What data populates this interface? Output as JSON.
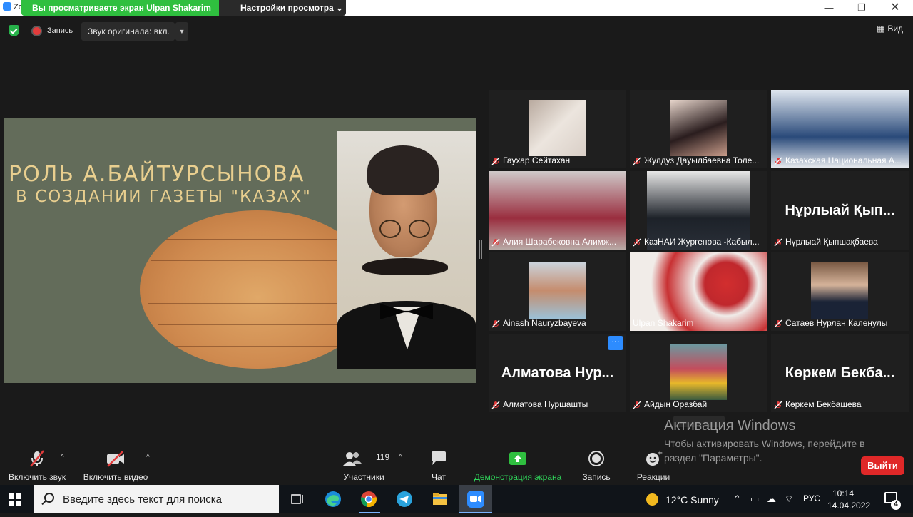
{
  "window": {
    "app_title": "Zo",
    "share_banner": "Вы просматриваете экран Ulpan Shakarim",
    "view_settings": "Настройки просмотра",
    "minimize_icon": "minimize-icon",
    "maximize_icon": "restore-icon",
    "close_icon": "close-icon"
  },
  "meeting_bar": {
    "recording_label": "Запись",
    "original_sound": "Звук оригинала: вкл.",
    "view_label": "Вид"
  },
  "slide": {
    "title_line1": "РОЛЬ А.БАЙТУРСЫНОВА",
    "title_line2": "В СОЗДАНИИ ГАЗЕТЫ \"КАЗАХ\""
  },
  "participants": [
    {
      "name": "Гаухар Сейтахан",
      "muted": true,
      "kind": "photo"
    },
    {
      "name": "Жулдуз Дауылбаевна Толе...",
      "muted": true,
      "kind": "photo"
    },
    {
      "name": "Казахская Национальная А...",
      "muted": true,
      "kind": "video"
    },
    {
      "name": "Алия Шарабековна Алимж...",
      "muted": true,
      "kind": "video"
    },
    {
      "name": "КазНАИ Жургенова -Кабыл...",
      "muted": true,
      "kind": "video"
    },
    {
      "name": "Нұрлыай Қыпшақбаева",
      "big_name": "Нұрлыай Қып...",
      "muted": true,
      "kind": "text"
    },
    {
      "name": "Ainash Nauryzbayeva",
      "muted": true,
      "kind": "photo"
    },
    {
      "name": "Ulpan Shakarim",
      "muted": false,
      "kind": "video",
      "active": true
    },
    {
      "name": "Сатаев Нурлан Каленулы",
      "muted": true,
      "kind": "photo"
    },
    {
      "name": "Алматова Нуршашты",
      "big_name": "Алматова Нур...",
      "muted": true,
      "kind": "text"
    },
    {
      "name": "Айдын Оразбай",
      "muted": true,
      "kind": "photo"
    },
    {
      "name": "Көркем Бекбашева",
      "big_name": "Көркем Бекба...",
      "muted": true,
      "kind": "text"
    }
  ],
  "more_button": "···",
  "watermark": {
    "title": "Активация Windows",
    "text": "Чтобы активировать Windows, перейдите в раздел \"Параметры\"."
  },
  "toolbar": {
    "unmute": "Включить звук",
    "start_video": "Включить видео",
    "participants": "Участники",
    "participants_count": "119",
    "chat": "Чат",
    "share": "Демонстрация экрана",
    "record": "Запись",
    "reactions": "Реакции",
    "leave": "Выйти"
  },
  "taskbar": {
    "search_placeholder": "Введите здесь текст для поиска",
    "weather_temp": "12°C",
    "weather_desc": "Sunny",
    "language": "РУС",
    "time": "10:14",
    "date": "14.04.2022",
    "notifications": "4"
  },
  "colors": {
    "share_banner": "#2fbf3f",
    "leave": "#e02828",
    "active_speaker": "#eef28e",
    "slide_bg": "#636c5a",
    "slide_text": "#e9cf8f"
  }
}
